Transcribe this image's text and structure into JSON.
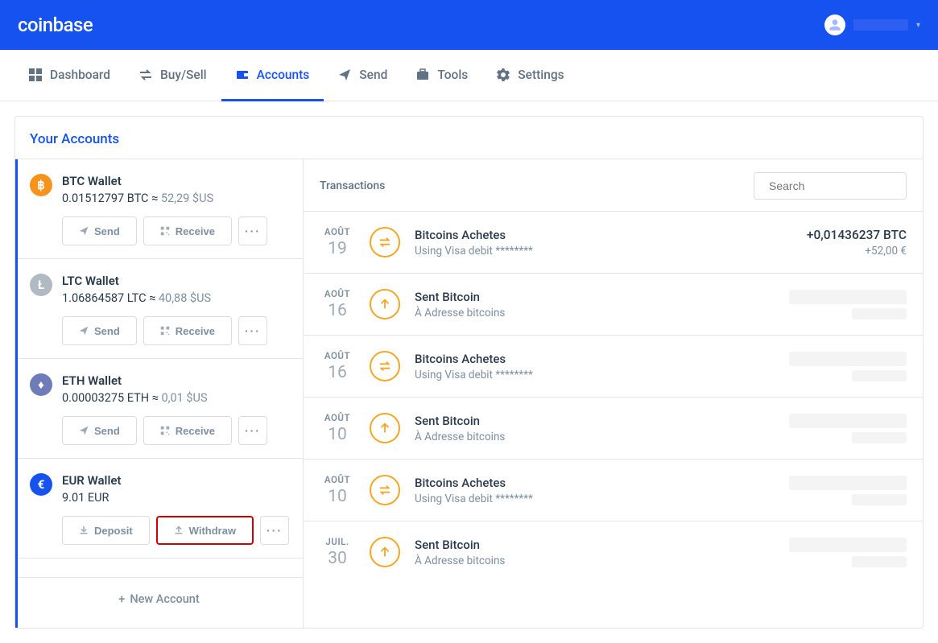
{
  "app": {
    "name": "coinbase"
  },
  "nav": {
    "items": [
      {
        "label": "Dashboard"
      },
      {
        "label": "Buy/Sell"
      },
      {
        "label": "Accounts"
      },
      {
        "label": "Send"
      },
      {
        "label": "Tools"
      },
      {
        "label": "Settings"
      }
    ]
  },
  "panel": {
    "title": "Your Accounts",
    "new_account_label": "New Account",
    "buttons": {
      "send": "Send",
      "receive": "Receive",
      "deposit": "Deposit",
      "withdraw": "Withdraw",
      "more": "···"
    }
  },
  "accounts": [
    {
      "name": "BTC Wallet",
      "balance": "0.01512797 BTC",
      "fiat": "52,29 $US",
      "symbol": "฿",
      "color": "#f7931a",
      "kind": "crypto"
    },
    {
      "name": "LTC Wallet",
      "balance": "1.06864587 LTC",
      "fiat": "40,88 $US",
      "symbol": "Ł",
      "color": "#B1B9C3",
      "kind": "crypto"
    },
    {
      "name": "ETH Wallet",
      "balance": "0.00003275 ETH",
      "fiat": "0,01 $US",
      "symbol": "♦",
      "color": "#6F7CBA",
      "kind": "crypto"
    },
    {
      "name": "EUR Wallet",
      "balance": "9.01 EUR",
      "fiat": "",
      "symbol": "€",
      "color": "#1652f0",
      "kind": "fiat"
    }
  ],
  "transactions": {
    "heading": "Transactions",
    "search_placeholder": "Search",
    "items": [
      {
        "month": "AOÛT",
        "day": "19",
        "type": "exchange",
        "title": "Bitcoins Achetes",
        "sub": "Using Visa debit ********",
        "amount": "+0,01436237 BTC",
        "amount_fiat": "+52,00 €",
        "amount_visible": true
      },
      {
        "month": "AOÛT",
        "day": "16",
        "type": "send",
        "title": "Sent Bitcoin",
        "sub": "À Adresse bitcoins",
        "amount": "",
        "amount_fiat": "",
        "amount_visible": false
      },
      {
        "month": "AOÛT",
        "day": "16",
        "type": "exchange",
        "title": "Bitcoins Achetes",
        "sub": "Using Visa debit ********",
        "amount": "",
        "amount_fiat": "",
        "amount_visible": false
      },
      {
        "month": "AOÛT",
        "day": "10",
        "type": "send",
        "title": "Sent Bitcoin",
        "sub": "À Adresse bitcoins",
        "amount": "",
        "amount_fiat": "",
        "amount_visible": false
      },
      {
        "month": "AOÛT",
        "day": "10",
        "type": "exchange",
        "title": "Bitcoins Achetes",
        "sub": "Using Visa debit ********",
        "amount": "",
        "amount_fiat": "",
        "amount_visible": false
      },
      {
        "month": "JUIL.",
        "day": "30",
        "type": "send",
        "title": "Sent Bitcoin",
        "sub": "À Adresse bitcoins",
        "amount": "",
        "amount_fiat": "",
        "amount_visible": false
      }
    ]
  }
}
